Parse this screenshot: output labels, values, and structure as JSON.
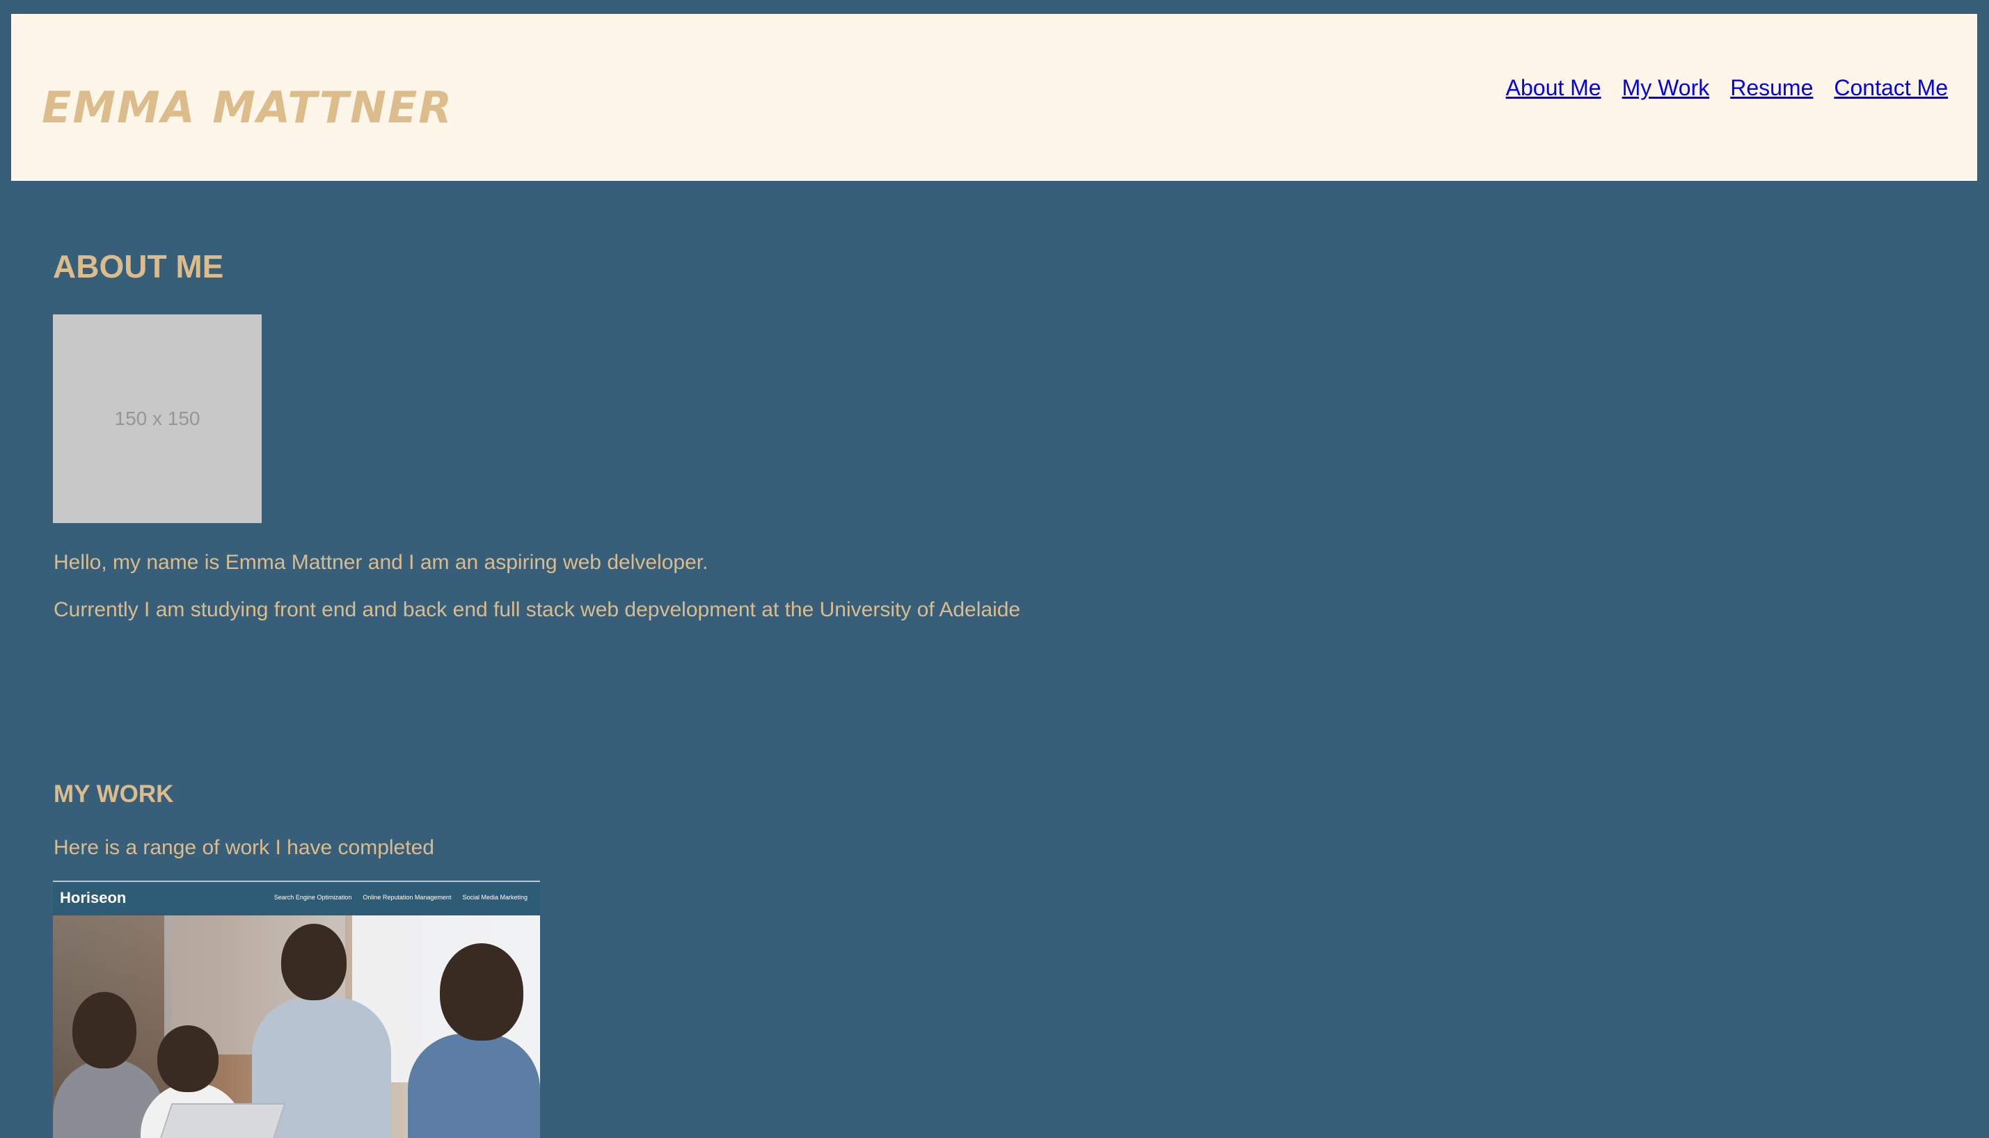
{
  "header": {
    "brand": "EMMA MATTNER",
    "nav": [
      "About Me",
      "My Work",
      "Resume",
      "Contact Me"
    ]
  },
  "about": {
    "title": "ABOUT ME",
    "image_placeholder": "150 x 150",
    "paragraphs": [
      "Hello, my name is Emma Mattner and I am an aspiring web delveloper.",
      "Currently I am studying front end and back end full stack web depvelopment at the University of Adelaide"
    ]
  },
  "work": {
    "title": "MY WORK",
    "intro": "Here is a range of work I have completed",
    "thumbnail": {
      "logo": "Horiseon",
      "nav": [
        "Search Engine Optimization",
        "Online Reputation Management",
        "Social Media Marketing"
      ]
    }
  },
  "colors": {
    "background": "#375f7a",
    "header_bg": "#fef6e8",
    "accent_text": "#dcbc8b",
    "link": "#0000ee"
  }
}
